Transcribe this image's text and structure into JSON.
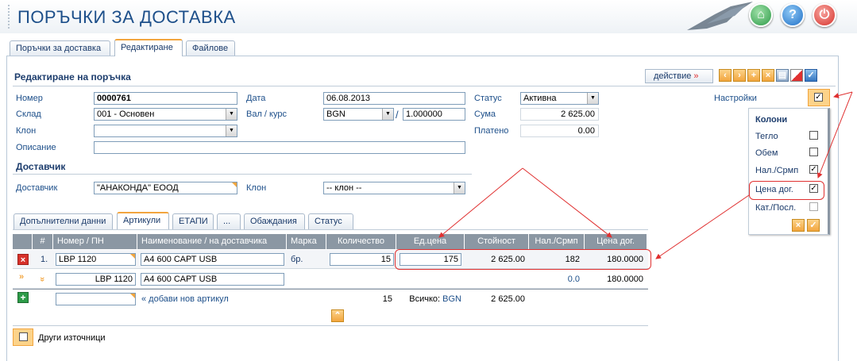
{
  "app": {
    "title": "ПОРЪЧКИ ЗА ДОСТАВКА"
  },
  "header_icons": [
    "home-icon",
    "help-icon",
    "power-icon"
  ],
  "top_tabs": [
    {
      "label": "Поръчки за доставка"
    },
    {
      "label": "Редактиране"
    },
    {
      "label": "Файлове"
    }
  ],
  "form": {
    "title": "Редактиране на поръчка",
    "action_label": "действие",
    "number_label": "Номер",
    "number_value": "0000761",
    "date_label": "Дата",
    "date_value": "06.08.2013",
    "status_label": "Статус",
    "status_value": "Активна",
    "warehouse_label": "Склад",
    "warehouse_value": "001 - Основен",
    "currency_label": "Вал / курс",
    "currency_value": "BGN",
    "rate_separator": "/",
    "rate_value": "1.000000",
    "sum_label": "Сума",
    "sum_value": "2 625.00",
    "branch_label": "Клон",
    "branch_value": "",
    "paid_label": "Платено",
    "paid_value": "0.00",
    "description_label": "Описание",
    "description_value": "",
    "supplier_section": "Доставчик",
    "supplier_label": "Доставчик",
    "supplier_value": "\"АНАКОНДА\" ЕООД",
    "supplier_branch_label": "Клон",
    "supplier_branch_value": "-- клон --",
    "settings_label": "Настройки"
  },
  "settings_panel": {
    "title": "Колони",
    "items": [
      {
        "label": "Тегло",
        "checked": false
      },
      {
        "label": "Обем",
        "checked": false
      },
      {
        "label": "Нал./Срмп",
        "checked": true
      },
      {
        "label": "Цена дог.",
        "checked": true
      },
      {
        "label": "Кат./Посл.",
        "checked": false
      }
    ]
  },
  "inner_tabs": [
    {
      "label": "Допълнителни данни"
    },
    {
      "label": "Артикули"
    },
    {
      "label": "ЕТАПИ"
    },
    {
      "label": "..."
    },
    {
      "label": "Обаждания"
    },
    {
      "label": "Статус"
    }
  ],
  "grid": {
    "headers": [
      "#",
      "Номер / ПН",
      "Наименование / на доставчика",
      "Марка",
      "Количество",
      "Ед.цена",
      "Стойност",
      "Нал./Срмп",
      "Цена дог."
    ],
    "row1": {
      "num": "1.",
      "code": "LBP 1120",
      "name": "A4 600 САРТ USB",
      "brand": "бр.",
      "qty": "15",
      "unit_price": "175",
      "value": "2 625.00",
      "stock": "182",
      "contract_price": "180.0000"
    },
    "row2": {
      "code": "LBP 1120",
      "name": "A4 600 САРТ USB",
      "stock": "0.0",
      "contract_price": "180.0000"
    },
    "add_label": "« добави нов артикул",
    "total_qty": "15",
    "total_label": "Всичко:",
    "total_currency": "BGN",
    "total_value": "2 625.00"
  },
  "other_sources_label": "Други източници",
  "colors": {
    "accent": "#f2a53e",
    "title": "#1d4f8a",
    "grid_header": "#8b97a3",
    "annotation": "#e03030"
  }
}
